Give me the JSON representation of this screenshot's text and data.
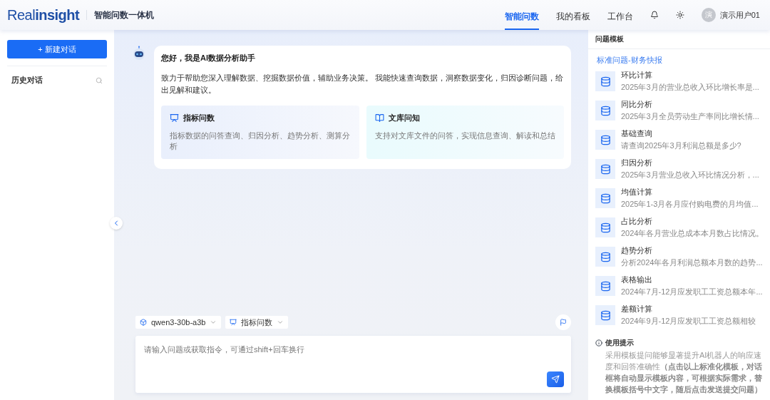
{
  "header": {
    "logo": {
      "part1": "Real",
      "part2": "insight"
    },
    "product": "智能问数一体机",
    "nav": [
      {
        "label": "智能问数",
        "selected": true
      },
      {
        "label": "我的看板",
        "selected": false
      },
      {
        "label": "工作台",
        "selected": false
      }
    ],
    "user": {
      "avatar": "演",
      "name": "演示用户01"
    }
  },
  "sidebar": {
    "new_button": "+ 新建对话",
    "history_title": "历史对话"
  },
  "welcome": {
    "title": "您好，我是AI数据分析助手",
    "intro": "致力于帮助您深入理解数据、挖掘数据价值，辅助业务决策。 我能快速查询数据，洞察数据变化，归因诊断问题，给出见解和建议。",
    "cards": [
      {
        "kind": "metric",
        "title": "指标问数",
        "desc": "指标数据的问答查询、归因分析、趋势分析、测算分析"
      },
      {
        "kind": "library",
        "title": "文库问知",
        "desc": "支持对文库文件的问答，实现信息查询、解读和总结"
      }
    ]
  },
  "composer": {
    "model": "qwen3-30b-a3b",
    "mode": "指标问数",
    "placeholder": "请输入问题或获取指令，可通过shift+回车换行"
  },
  "templates": {
    "title": "问题模板",
    "category": "标准问题-财务快报",
    "items": [
      {
        "title": "环比计算",
        "desc": "2025年3月的营业总收入环比增长率是..."
      },
      {
        "title": "同比分析",
        "desc": "2025年3月全员劳动生产率同比增长情..."
      },
      {
        "title": "基础查询",
        "desc": "请查询2025年3月利润总额是多少?"
      },
      {
        "title": "归因分析",
        "desc": "2025年3月营业总收入环比情况分析，..."
      },
      {
        "title": "均值计算",
        "desc": "2025年1-3月各月应付购电费的月均值..."
      },
      {
        "title": "占比分析",
        "desc": "2024年各月营业总成本本月数占比情况。"
      },
      {
        "title": "趋势分析",
        "desc": "分析2024年各月利润总额本月数的趋势..."
      },
      {
        "title": "表格输出",
        "desc": "2024年7月-12月应发职工工资总额本年..."
      },
      {
        "title": "差额计算",
        "desc": "2024年9月-12月应发职工工资总额相较"
      }
    ],
    "tip_title": "使用提示",
    "tip": "采用模板提问能够显著提升AI机器人的响应速度和回答准确性**（点击以上标准化模板，对话框将自动显示模板内容，可根据实际需求，替换模板括号中文字，随后点击发送提交问题）**"
  }
}
